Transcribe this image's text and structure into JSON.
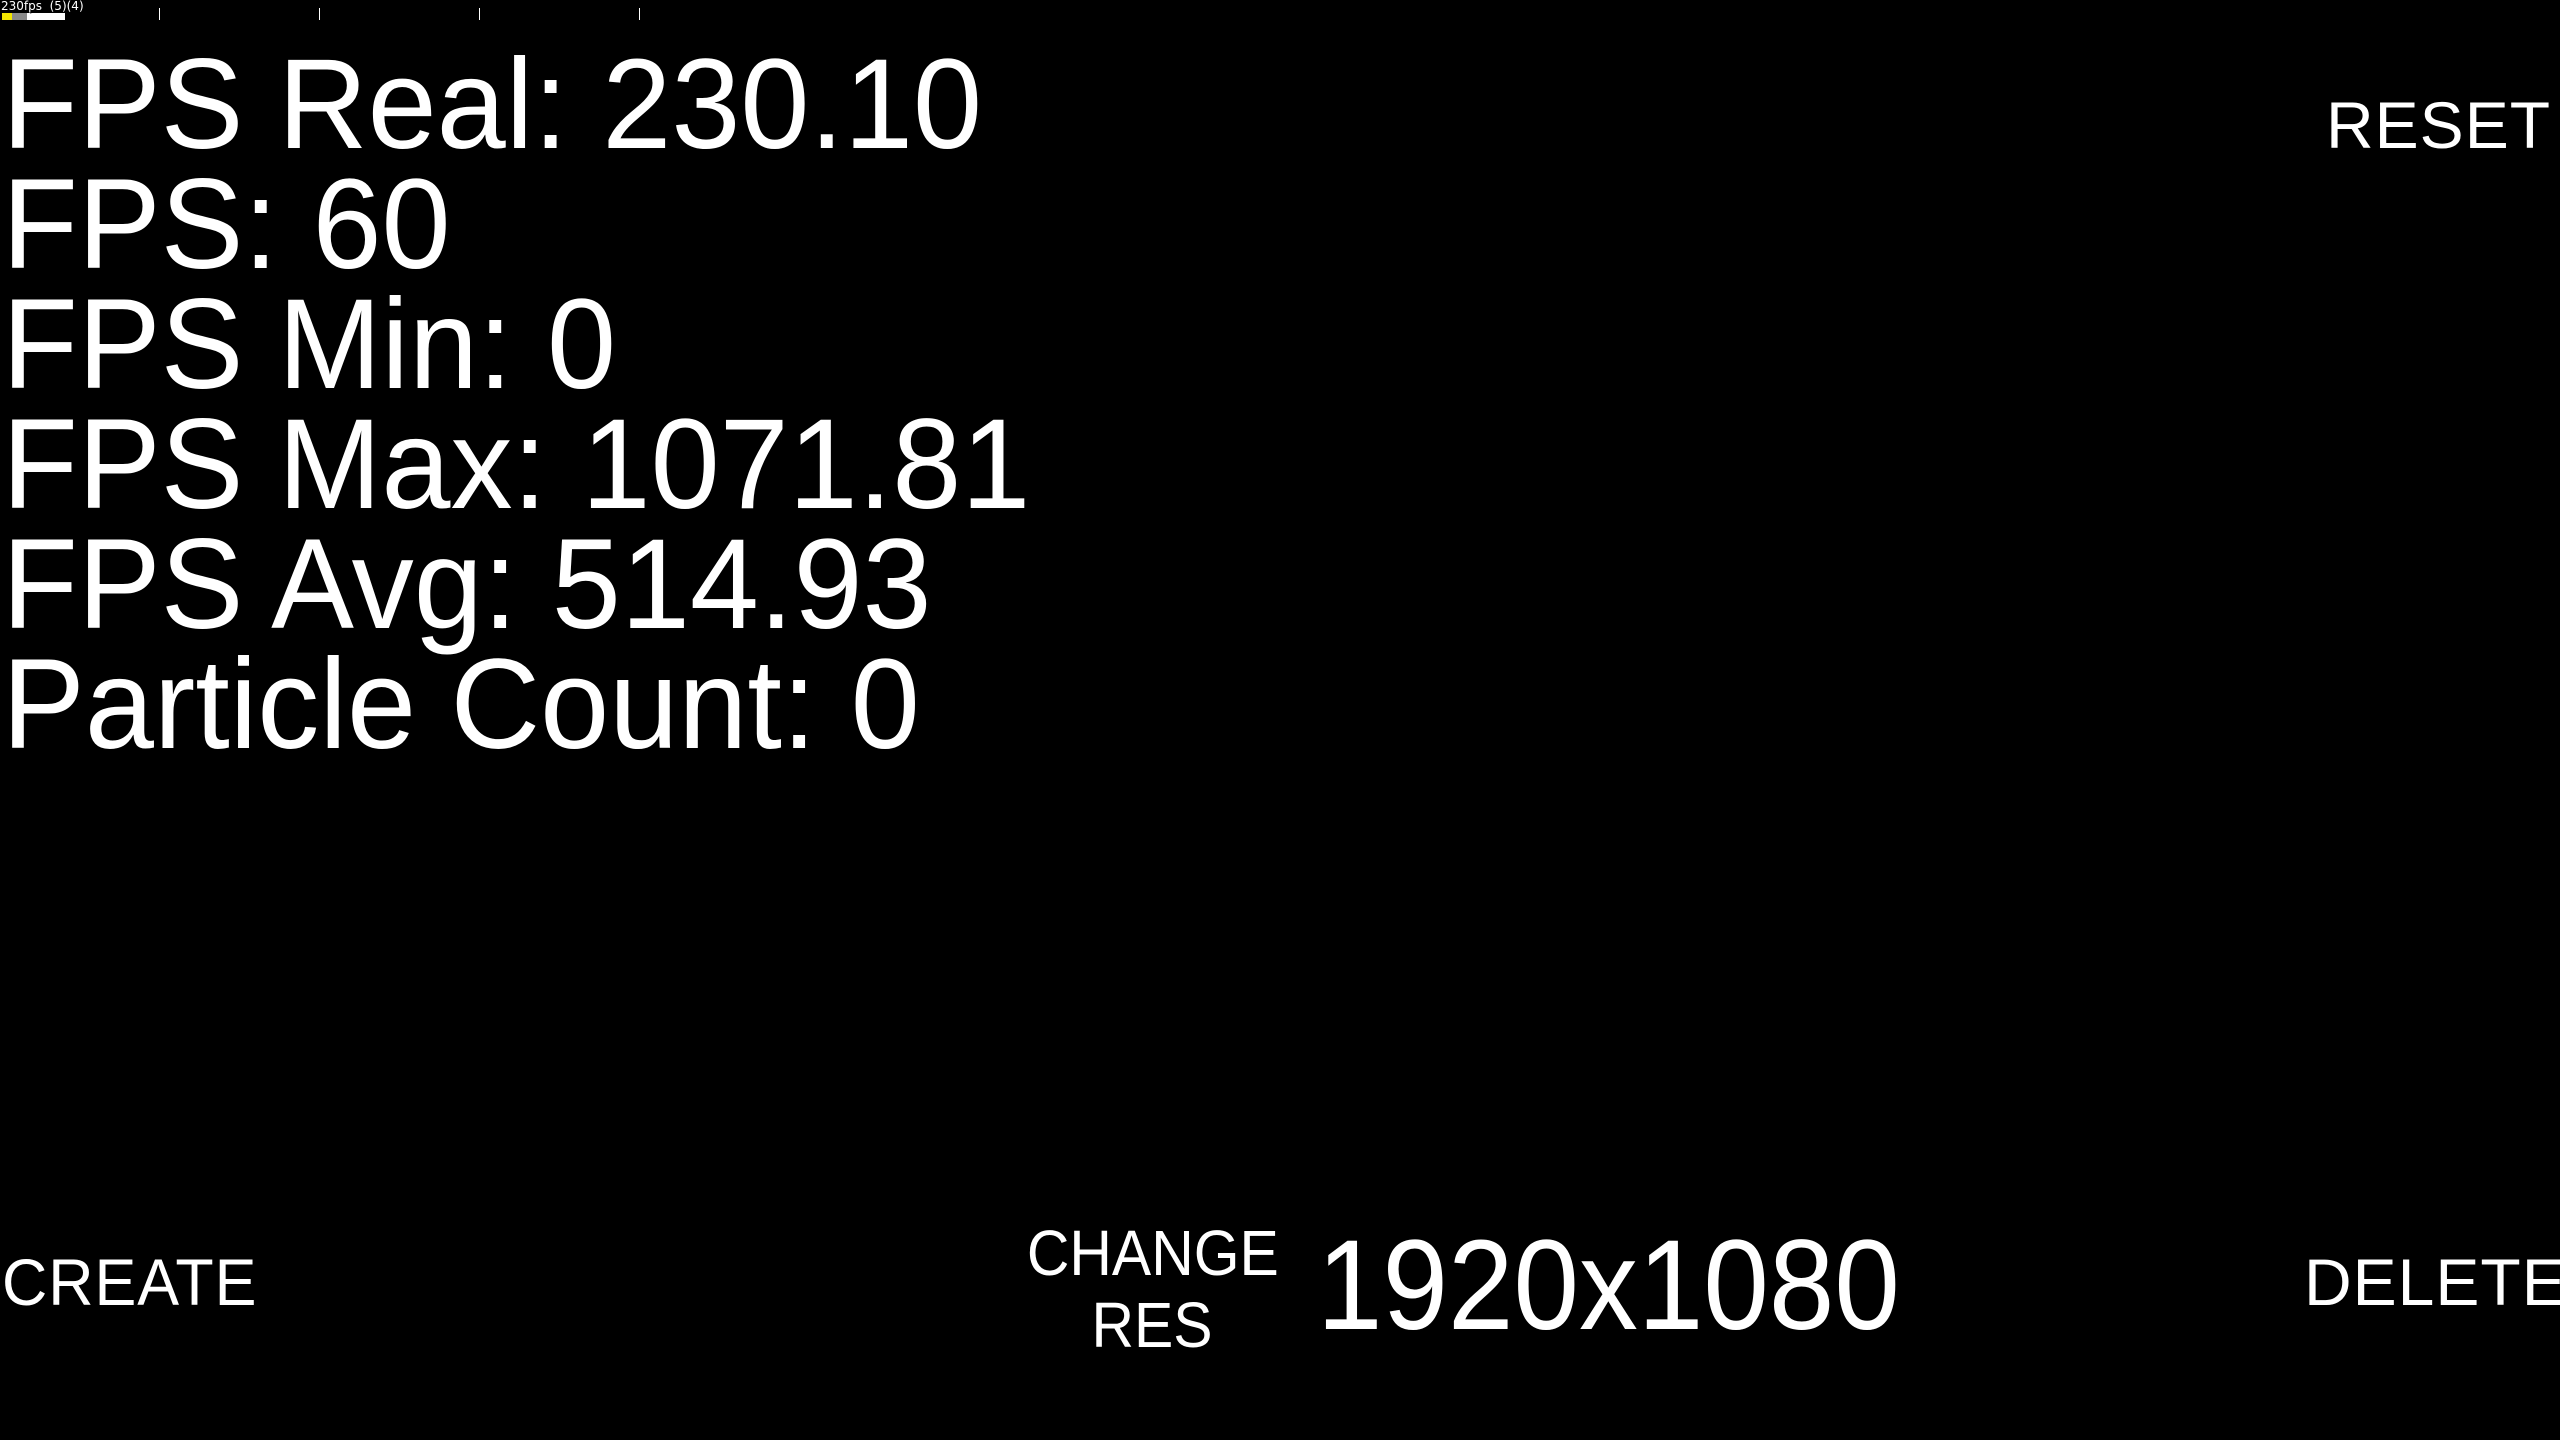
{
  "debug_overlay": {
    "text": "230fps  (5)(4)",
    "bar_colors": [
      "#f2e600",
      "#8a8a8a",
      "#ffffff"
    ],
    "tick_count": 4
  },
  "stats": {
    "fps_real": {
      "label": "FPS Real: ",
      "value": "230.10"
    },
    "fps": {
      "label": "FPS: ",
      "value": "60"
    },
    "fps_min": {
      "label": "FPS Min: ",
      "value": "0"
    },
    "fps_max": {
      "label": "FPS Max: ",
      "value": "1071.81"
    },
    "fps_avg": {
      "label": "FPS Avg: ",
      "value": "514.93"
    },
    "particle_count": {
      "label": "Particle Count: ",
      "value": "0"
    }
  },
  "buttons": {
    "reset": "RESET",
    "create": "CREATE",
    "delete": "DELETE",
    "change_res_line1": "CHANGE",
    "change_res_line2": "RES"
  },
  "resolution": {
    "current": "1920x1080"
  },
  "colors": {
    "background": "#000000",
    "text": "#ffffff"
  }
}
